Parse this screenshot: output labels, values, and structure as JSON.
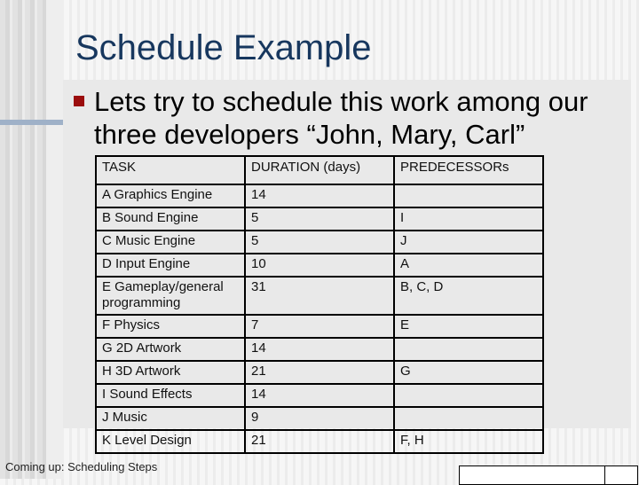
{
  "slide": {
    "title": "Schedule Example",
    "bullet": "Lets try to schedule this work among our three developers “John, Mary, Carl”",
    "bullet_color": "#9b0d0d",
    "title_color": "#17375e",
    "footer": "Coming up: Scheduling Steps"
  },
  "table": {
    "headers": [
      "TASK",
      "DURATION (days)",
      "PREDECESSORs"
    ],
    "rows": [
      {
        "task": "A Graphics Engine",
        "duration": "14",
        "predecessors": ""
      },
      {
        "task": "B Sound Engine",
        "duration": "5",
        "predecessors": "I"
      },
      {
        "task": "C Music Engine",
        "duration": "5",
        "predecessors": "J"
      },
      {
        "task": "D Input Engine",
        "duration": "10",
        "predecessors": "A"
      },
      {
        "task": "E Gameplay/general programming",
        "duration": "31",
        "predecessors": "B, C, D"
      },
      {
        "task": "F Physics",
        "duration": "7",
        "predecessors": "E"
      },
      {
        "task": "G 2D Artwork",
        "duration": "14",
        "predecessors": ""
      },
      {
        "task": "H 3D Artwork",
        "duration": "21",
        "predecessors": "G"
      },
      {
        "task": "I Sound Effects",
        "duration": "14",
        "predecessors": ""
      },
      {
        "task": "J Music",
        "duration": "9",
        "predecessors": ""
      },
      {
        "task": "K Level Design",
        "duration": "21",
        "predecessors": "F, H"
      }
    ]
  }
}
